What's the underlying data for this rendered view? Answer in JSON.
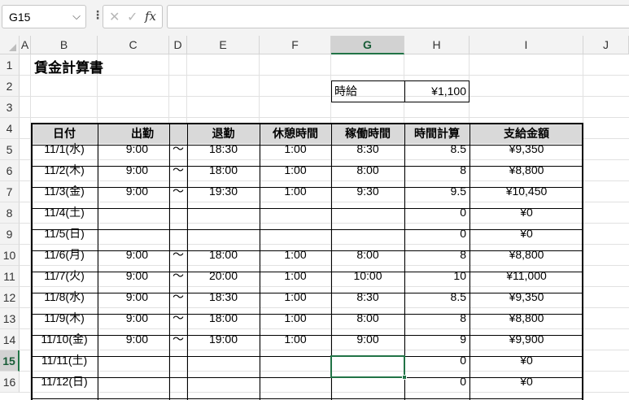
{
  "formula_bar": {
    "name_box": "G15",
    "dots": "⋮",
    "cancel": "✕",
    "enter": "✓",
    "fx": "fx",
    "formula": ""
  },
  "columns": [
    "A",
    "B",
    "C",
    "D",
    "E",
    "F",
    "G",
    "H",
    "I",
    "J"
  ],
  "rows": [
    "1",
    "2",
    "3",
    "4",
    "5",
    "6",
    "7",
    "8",
    "9",
    "10",
    "11",
    "12",
    "13",
    "14",
    "15",
    "16"
  ],
  "sheet": {
    "title": "賃金計算書",
    "wage_label": "時給",
    "wage_value": "¥1,100",
    "headers": {
      "date": "日付",
      "start": "出勤",
      "end": "退勤",
      "break": "休憩時間",
      "work": "稼働時間",
      "hours": "時間計算",
      "pay": "支給金額"
    },
    "records": [
      {
        "date": "11/1(水)",
        "start": "9:00",
        "tilde": "～",
        "end": "18:30",
        "break": "1:00",
        "work": "8:30",
        "hours": "8.5",
        "pay": "¥9,350"
      },
      {
        "date": "11/2(木)",
        "start": "9:00",
        "tilde": "～",
        "end": "18:00",
        "break": "1:00",
        "work": "8:00",
        "hours": "8",
        "pay": "¥8,800"
      },
      {
        "date": "11/3(金)",
        "start": "9:00",
        "tilde": "～",
        "end": "19:30",
        "break": "1:00",
        "work": "9:30",
        "hours": "9.5",
        "pay": "¥10,450"
      },
      {
        "date": "11/4(土)",
        "start": "",
        "tilde": "",
        "end": "",
        "break": "",
        "work": "",
        "hours": "0",
        "pay": "¥0"
      },
      {
        "date": "11/5(日)",
        "start": "",
        "tilde": "",
        "end": "",
        "break": "",
        "work": "",
        "hours": "0",
        "pay": "¥0"
      },
      {
        "date": "11/6(月)",
        "start": "9:00",
        "tilde": "～",
        "end": "18:00",
        "break": "1:00",
        "work": "8:00",
        "hours": "8",
        "pay": "¥8,800"
      },
      {
        "date": "11/7(火)",
        "start": "9:00",
        "tilde": "～",
        "end": "20:00",
        "break": "1:00",
        "work": "10:00",
        "hours": "10",
        "pay": "¥11,000"
      },
      {
        "date": "11/8(水)",
        "start": "9:00",
        "tilde": "～",
        "end": "18:30",
        "break": "1:00",
        "work": "8:30",
        "hours": "8.5",
        "pay": "¥9,350"
      },
      {
        "date": "11/9(木)",
        "start": "9:00",
        "tilde": "～",
        "end": "18:00",
        "break": "1:00",
        "work": "8:00",
        "hours": "8",
        "pay": "¥8,800"
      },
      {
        "date": "11/10(金)",
        "start": "9:00",
        "tilde": "～",
        "end": "19:00",
        "break": "1:00",
        "work": "9:00",
        "hours": "9",
        "pay": "¥9,900"
      },
      {
        "date": "11/11(土)",
        "start": "",
        "tilde": "",
        "end": "",
        "break": "",
        "work": "",
        "hours": "0",
        "pay": "¥0"
      },
      {
        "date": "11/12(日)",
        "start": "",
        "tilde": "",
        "end": "",
        "break": "",
        "work": "",
        "hours": "0",
        "pay": "¥0"
      }
    ]
  },
  "selection": {
    "column": "G",
    "row": "15"
  },
  "colors": {
    "accent": "#217346",
    "header_fill": "#d9d9d9"
  }
}
